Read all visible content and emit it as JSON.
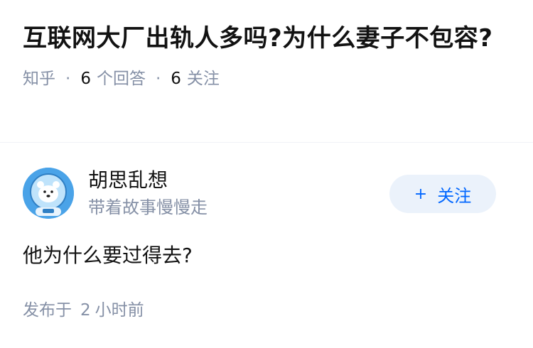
{
  "question": {
    "title": "互联网大厂出轨人多吗?为什么妻子不包容?",
    "source": "知乎",
    "answers_count": "6",
    "answers_label": "个回答",
    "followers_count": "6",
    "followers_label": "关注"
  },
  "author": {
    "name": "胡思乱想",
    "bio": "带着故事慢慢走",
    "avatar_icon": "bear-astronaut-avatar",
    "follow_label": "关注",
    "follow_icon": "plus-icon"
  },
  "answer": {
    "content": "他为什么要过得去?",
    "time_prefix": "发布于",
    "time_value": "2",
    "time_unit": "小时前"
  },
  "colors": {
    "accent": "#0066ff",
    "follow_bg": "#ebf2fb",
    "meta_gray": "#8590a6",
    "text": "#121212"
  }
}
